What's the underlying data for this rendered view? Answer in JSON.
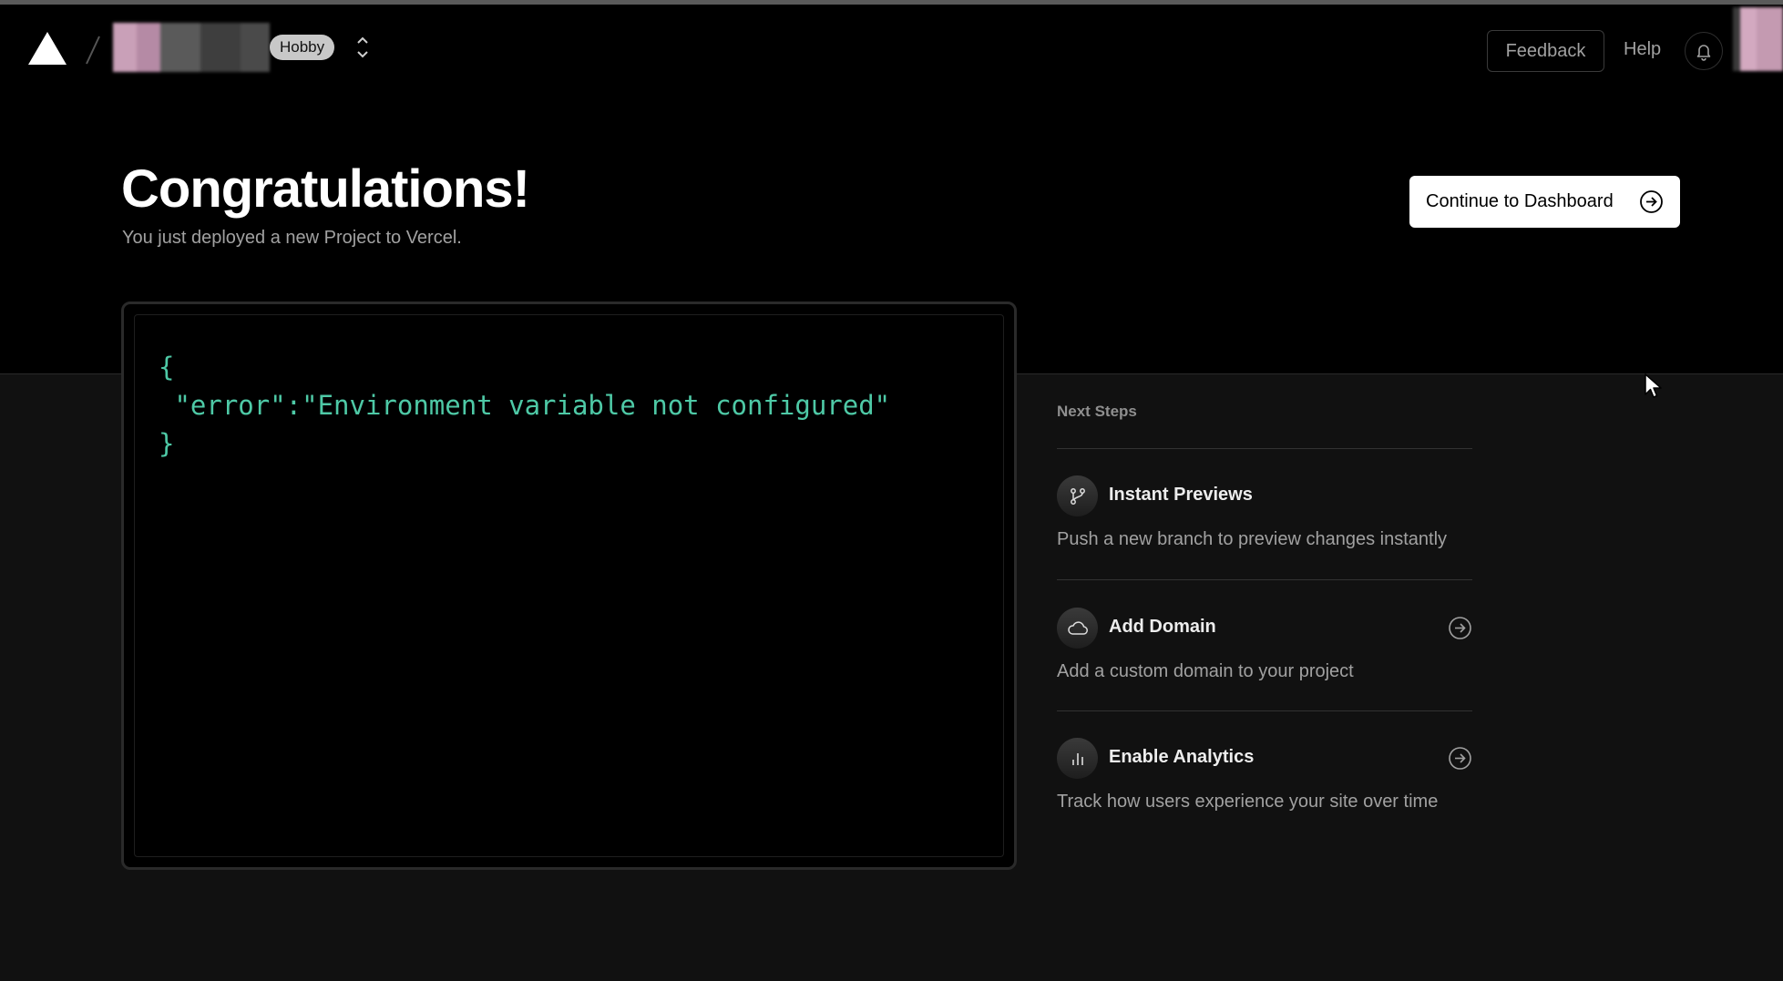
{
  "header": {
    "plan_badge": "Hobby",
    "feedback_label": "Feedback",
    "help_label": "Help"
  },
  "hero": {
    "title": "Congratulations!",
    "subtitle": "You just deployed a new Project to Vercel.",
    "continue_label": "Continue to Dashboard"
  },
  "preview": {
    "lines": [
      "{",
      " \"error\":\"Environment variable not configured\"",
      "}"
    ]
  },
  "next_steps": {
    "title": "Next Steps",
    "items": [
      {
        "title": "Instant Previews",
        "description": "Push a new branch to preview changes instantly",
        "icon": "git-branch-icon"
      },
      {
        "title": "Add Domain",
        "description": "Add a custom domain to your project",
        "icon": "cloud-icon"
      },
      {
        "title": "Enable Analytics",
        "description": "Track how users experience your site over time",
        "icon": "bar-chart-icon"
      }
    ]
  },
  "colors": {
    "background": "#111111",
    "header_background": "#000000",
    "code_green": "#4ec9a6",
    "button_white": "#ffffff"
  }
}
